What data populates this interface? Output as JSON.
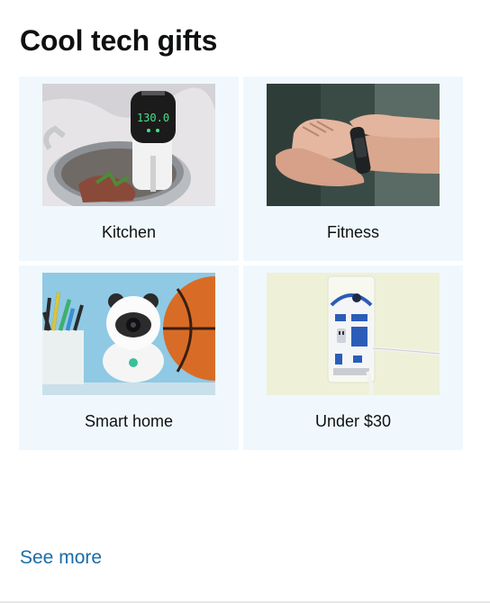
{
  "widget": {
    "title": "Cool tech gifts",
    "see_more": "See more"
  },
  "tiles": [
    {
      "label": "Kitchen",
      "image": "sous-vide-cooker-photo",
      "readout": "130.0"
    },
    {
      "label": "Fitness",
      "image": "fitness-tracker-wrist-photo"
    },
    {
      "label": "Smart home",
      "image": "panda-smart-camera-photo"
    },
    {
      "label": "Under $30",
      "image": "r2d2-wall-charger-photo"
    }
  ]
}
